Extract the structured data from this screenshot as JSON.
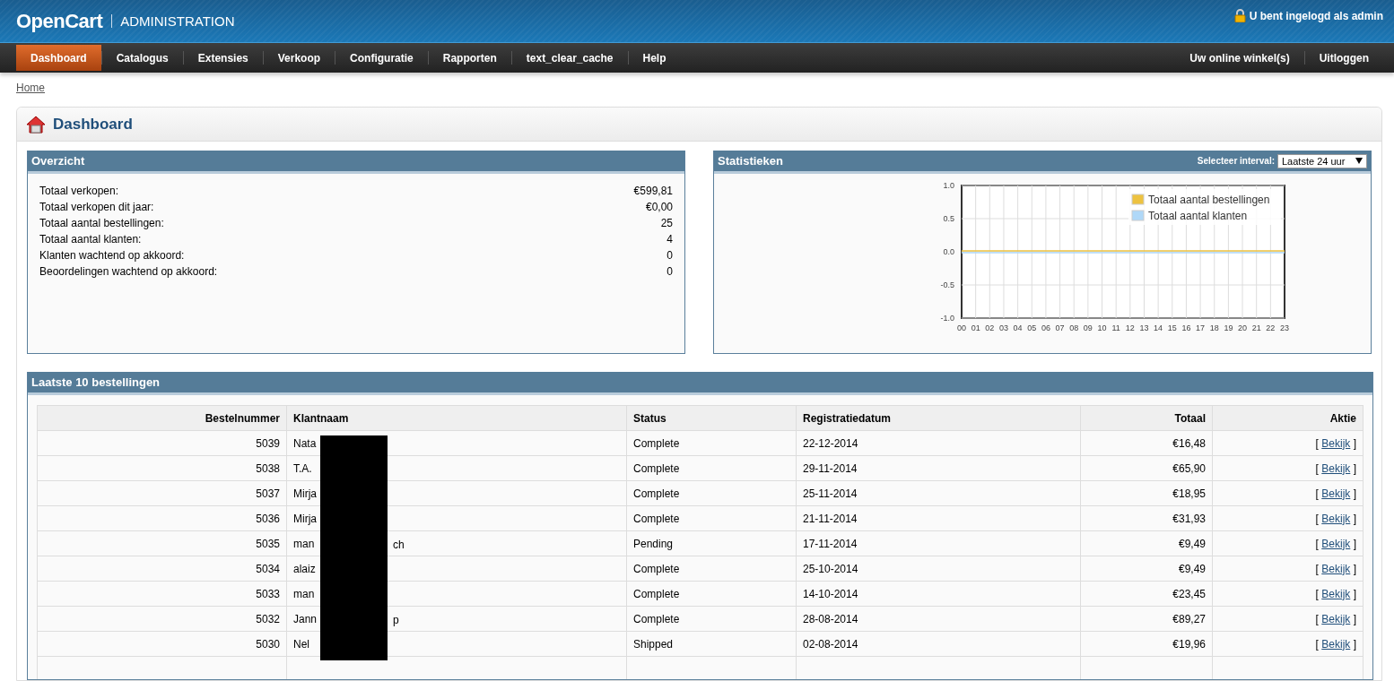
{
  "header": {
    "logo": "OpenCart",
    "subtitle": "ADMINISTRATION",
    "login_text": "U bent ingelogd als admin"
  },
  "menu": [
    {
      "label": "Dashboard",
      "selected": true
    },
    {
      "label": "Catalogus",
      "selected": false
    },
    {
      "label": "Extensies",
      "selected": false
    },
    {
      "label": "Verkoop",
      "selected": false
    },
    {
      "label": "Configuratie",
      "selected": false
    },
    {
      "label": "Rapporten",
      "selected": false
    },
    {
      "label": "text_clear_cache",
      "selected": false
    },
    {
      "label": "Help",
      "selected": false
    }
  ],
  "menu_right": [
    "Uw online winkel(s)",
    "Uitloggen"
  ],
  "breadcrumb": [
    "Home"
  ],
  "page_title": "Dashboard",
  "overview": {
    "title": "Overzicht",
    "rows": [
      {
        "label": "Totaal verkopen:",
        "value": "€599,81"
      },
      {
        "label": "Totaal verkopen dit jaar:",
        "value": "€0,00"
      },
      {
        "label": "Totaal aantal bestellingen:",
        "value": "25"
      },
      {
        "label": "Totaal aantal klanten:",
        "value": "4"
      },
      {
        "label": "Klanten wachtend op akkoord:",
        "value": "0"
      },
      {
        "label": "Beoordelingen wachtend op akkoord:",
        "value": "0"
      }
    ]
  },
  "statistics": {
    "title": "Statistieken",
    "interval_label": "Selecteer interval:",
    "interval_value": "Laatste 24 uur",
    "chart_data": {
      "type": "line",
      "x": [
        "00",
        "01",
        "02",
        "03",
        "04",
        "05",
        "06",
        "07",
        "08",
        "09",
        "10",
        "11",
        "12",
        "13",
        "14",
        "15",
        "16",
        "17",
        "18",
        "19",
        "20",
        "21",
        "22",
        "23"
      ],
      "series": [
        {
          "name": "Totaal aantal bestellingen",
          "color": "#edc240",
          "values": [
            0,
            0,
            0,
            0,
            0,
            0,
            0,
            0,
            0,
            0,
            0,
            0,
            0,
            0,
            0,
            0,
            0,
            0,
            0,
            0,
            0,
            0,
            0,
            0
          ]
        },
        {
          "name": "Totaal aantal klanten",
          "color": "#afd8f8",
          "values": [
            0,
            0,
            0,
            0,
            0,
            0,
            0,
            0,
            0,
            0,
            0,
            0,
            0,
            0,
            0,
            0,
            0,
            0,
            0,
            0,
            0,
            0,
            0,
            0
          ]
        }
      ],
      "grid": true,
      "legend": true,
      "ylim": [
        -1,
        1
      ],
      "yticks": [
        {
          "value": 1,
          "label": "1.0"
        },
        {
          "value": 0.5,
          "label": "0.5"
        },
        {
          "value": 0,
          "label": "0.0"
        },
        {
          "value": -0.5,
          "label": "-0.5"
        },
        {
          "value": -1,
          "label": "-1.0"
        }
      ]
    }
  },
  "orders": {
    "title": "Laatste 10 bestellingen",
    "columns": [
      "Bestelnummer",
      "Klantnaam",
      "Status",
      "Registratiedatum",
      "Totaal",
      "Aktie"
    ],
    "rows": [
      {
        "id": "5039",
        "customer": "Nata",
        "status": "Complete",
        "date": "22-12-2014",
        "total": "€16,48",
        "bracket_open": "[",
        "action": "Bekijk",
        "bracket_close": "]"
      },
      {
        "id": "5038",
        "customer": "T.A.",
        "status": "Complete",
        "date": "29-11-2014",
        "total": "€65,90",
        "bracket_open": "[",
        "action": "Bekijk",
        "bracket_close": "]"
      },
      {
        "id": "5037",
        "customer": "Mirja",
        "status": "Complete",
        "date": "25-11-2014",
        "total": "€18,95",
        "bracket_open": "[",
        "action": "Bekijk",
        "bracket_close": "]"
      },
      {
        "id": "5036",
        "customer": "Mirja",
        "status": "Complete",
        "date": "21-11-2014",
        "total": "€31,93",
        "bracket_open": "[",
        "action": "Bekijk",
        "bracket_close": "]"
      },
      {
        "id": "5035",
        "customer": "man",
        "customer_end": "ch",
        "status": "Pending",
        "date": "17-11-2014",
        "total": "€9,49",
        "bracket_open": "[",
        "action": "Bekijk",
        "bracket_close": "]"
      },
      {
        "id": "5034",
        "customer": "alaiz",
        "status": "Complete",
        "date": "25-10-2014",
        "total": "€9,49",
        "bracket_open": "[",
        "action": "Bekijk",
        "bracket_close": "]"
      },
      {
        "id": "5033",
        "customer": "man",
        "status": "Complete",
        "date": "14-10-2014",
        "total": "€23,45",
        "bracket_open": "[",
        "action": "Bekijk",
        "bracket_close": "]"
      },
      {
        "id": "5032",
        "customer": "Jann",
        "customer_end": "p",
        "status": "Complete",
        "date": "28-08-2014",
        "total": "€89,27",
        "bracket_open": "[",
        "action": "Bekijk",
        "bracket_close": "]"
      },
      {
        "id": "5030",
        "customer": "Nel",
        "status": "Shipped",
        "date": "02-08-2014",
        "total": "€19,96",
        "bracket_open": "[",
        "action": "Bekijk",
        "bracket_close": "]"
      }
    ]
  }
}
